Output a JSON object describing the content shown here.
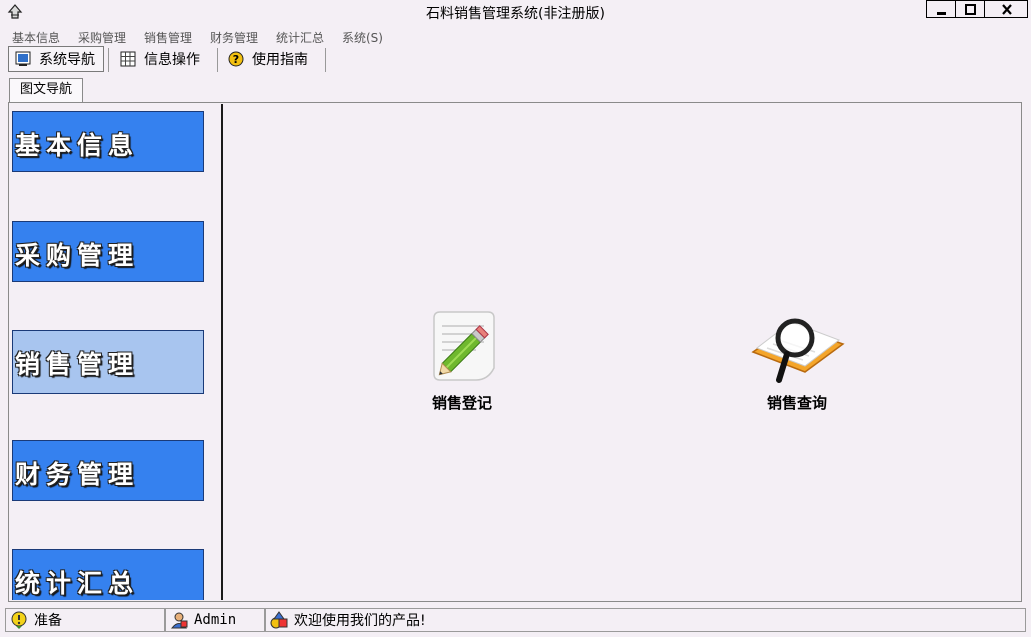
{
  "window": {
    "title": "石料销售管理系统(非注册版)"
  },
  "menu": [
    "基本信息",
    "采购管理",
    "销售管理",
    "财务管理",
    "统计汇总",
    "系统(S)"
  ],
  "toolbar": {
    "nav_label": "系统导航",
    "ops_label": "信息操作",
    "guide_label": "使用指南"
  },
  "tab": {
    "label": "图文导航"
  },
  "nav_buttons": [
    "基本信息",
    "采购管理",
    "销售管理",
    "财务管理",
    "统计汇总"
  ],
  "active_nav": "销售管理",
  "content": {
    "items": [
      {
        "label": "销售登记",
        "icon": "pencil-note-icon"
      },
      {
        "label": "销售查询",
        "icon": "magnifier-book-icon"
      }
    ]
  },
  "status": {
    "ready": "准备",
    "user": "Admin",
    "message": "欢迎使用我们的产品!"
  },
  "colors": {
    "nav_button": "#3581ef",
    "nav_button_active": "#a8c5ef",
    "background": "#f4eff5"
  }
}
